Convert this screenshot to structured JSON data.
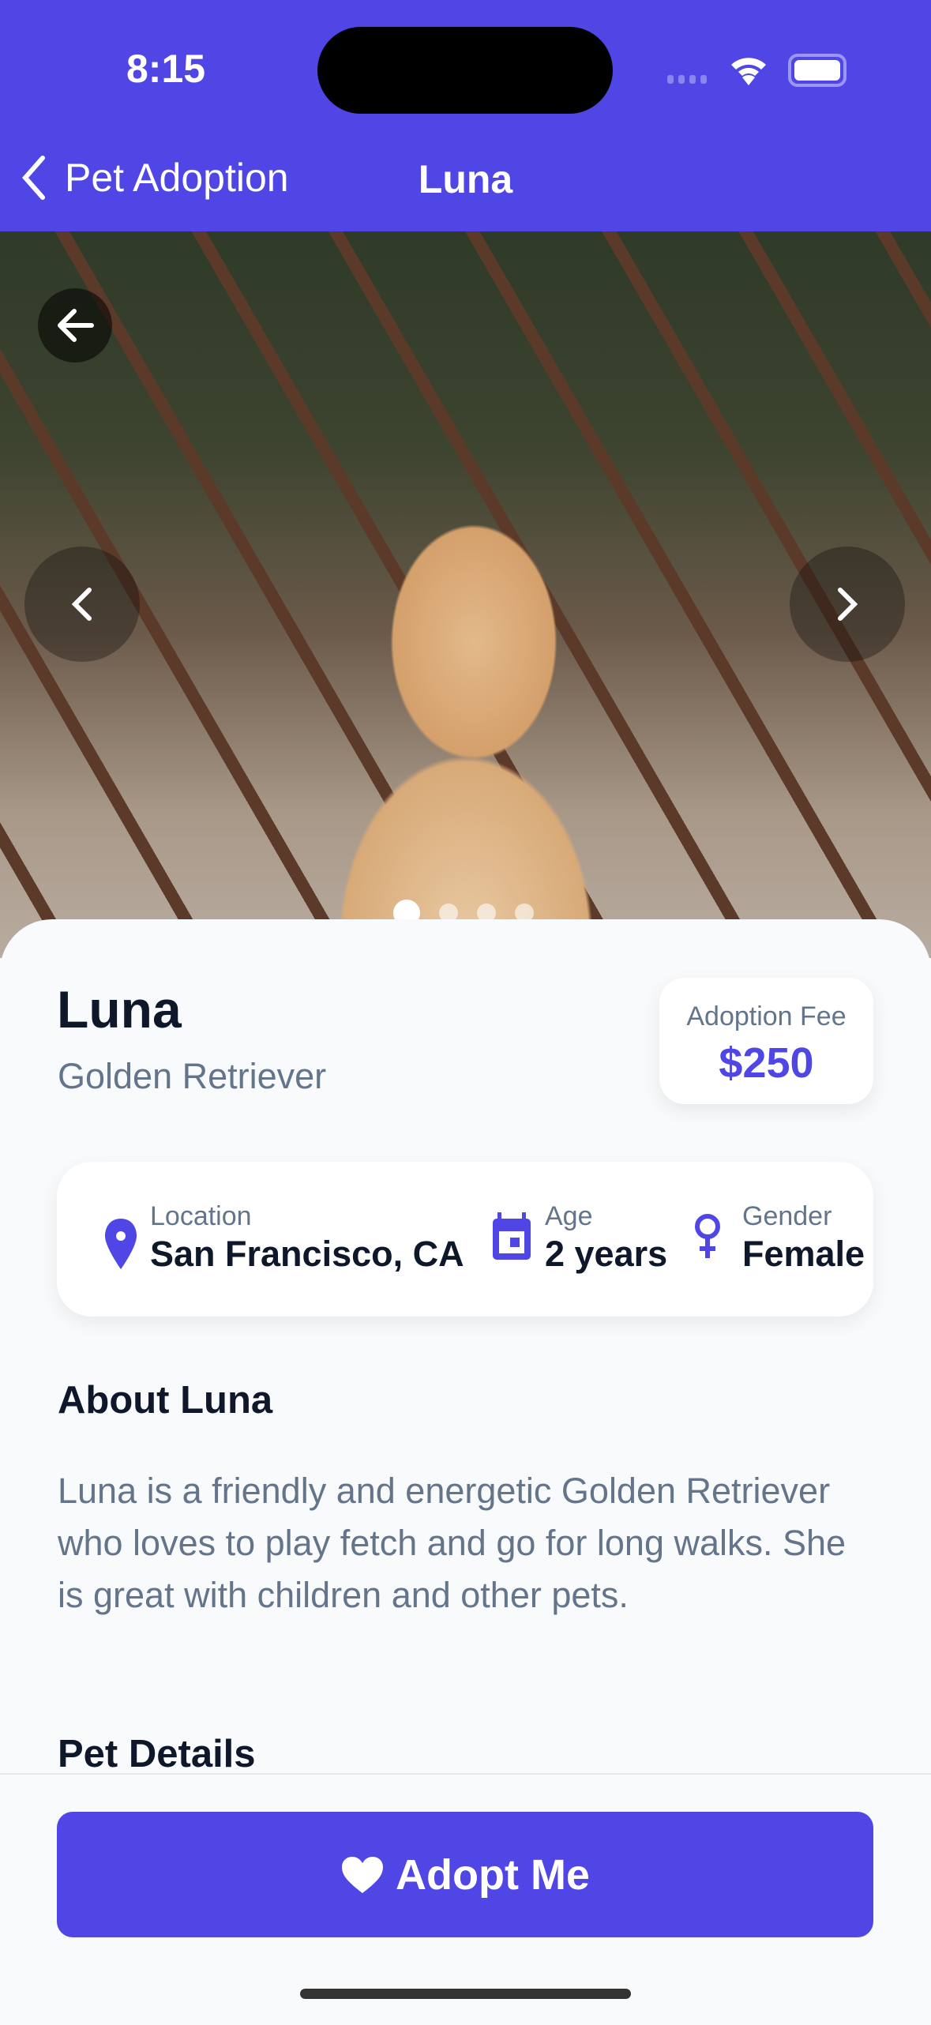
{
  "status_bar": {
    "time": "8:15"
  },
  "nav": {
    "back_label": "Pet Adoption",
    "title": "Luna"
  },
  "gallery": {
    "image_count": 4,
    "active_index": 0
  },
  "pet": {
    "name": "Luna",
    "breed": "Golden Retriever"
  },
  "fee": {
    "label": "Adoption Fee",
    "value": "$250"
  },
  "info": [
    {
      "icon": "location-pin-icon",
      "label": "Location",
      "value": "San Francisco, CA"
    },
    {
      "icon": "calendar-icon",
      "label": "Age",
      "value": "2 years"
    },
    {
      "icon": "female-icon",
      "label": "Gender",
      "value": "Female"
    }
  ],
  "about": {
    "title": "About Luna",
    "text": "Luna is a friendly and energetic Golden Retriever who loves to play fetch and go for long walks. She is great with children and other pets."
  },
  "details": {
    "title": "Pet Details"
  },
  "cta": {
    "label": "Adopt Me"
  },
  "colors": {
    "accent": "#4f46e5",
    "text": "#0f172a",
    "muted": "#64748b"
  }
}
